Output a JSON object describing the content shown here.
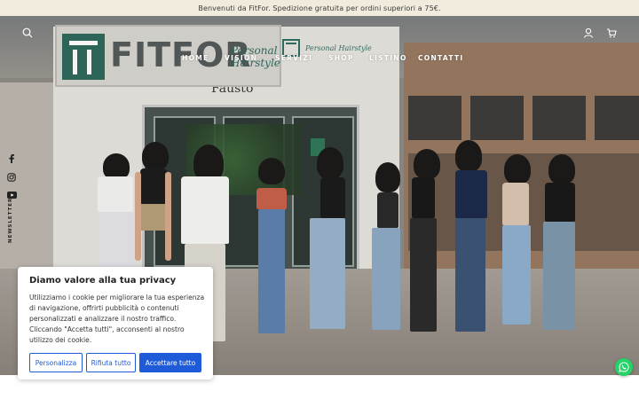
{
  "announcement": {
    "text": "Benvenuti da FitFor. Spedizione gratuita per ordini superiori a 75€."
  },
  "header": {
    "logo": {
      "brand": "Personal Hairstyle"
    },
    "nav": [
      "HOME",
      "VISION",
      "SERVIZI",
      "SHOP",
      "LISTINO",
      "CONTATTI"
    ],
    "icons": [
      "search-icon",
      "account-icon",
      "cart-icon"
    ]
  },
  "hero": {
    "sign_brand": "FITFOR",
    "sign_tagline": "Personal Hairstyle",
    "sign_name": "Fausto"
  },
  "social": {
    "icons": [
      "facebook-icon",
      "instagram-icon",
      "youtube-icon"
    ],
    "newsletter_label": "NEWSLETTER"
  },
  "cookie_banner": {
    "title": "Diamo valore alla tua privacy",
    "message": "Utilizziamo i cookie per migliorare la tua esperienza di navigazione, offrirti pubblicità o contenuti personalizzati e analizzare il nostro traffico. Cliccando \"Accetta tutti\", acconsenti al nostro utilizzo dei cookie.",
    "buttons": {
      "customize": "Personalizza",
      "reject": "Rifiuta tutto",
      "accept": "Accettare tutto"
    }
  },
  "colors": {
    "brand_green": "#2f6a5d",
    "accent_blue": "#1f5bd8",
    "announce_bg": "#f1ebdd",
    "whatsapp": "#25d366"
  }
}
